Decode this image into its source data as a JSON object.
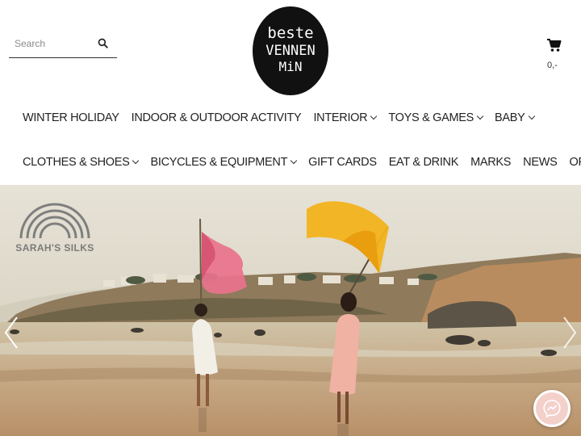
{
  "header": {
    "search": {
      "placeholder": "Search"
    },
    "logo": {
      "line1": "beste",
      "line2": "VENNEN",
      "line3": "MiN"
    },
    "cart": {
      "total": "0,-"
    }
  },
  "nav": {
    "row1": [
      {
        "label": "WINTER HOLIDAY",
        "has_dropdown": false
      },
      {
        "label": "INDOOR & OUTDOOR ACTIVITY",
        "has_dropdown": false
      },
      {
        "label": "INTERIOR",
        "has_dropdown": true
      },
      {
        "label": "TOYS & GAMES",
        "has_dropdown": true
      },
      {
        "label": "BABY",
        "has_dropdown": true
      }
    ],
    "row2": [
      {
        "label": "CLOTHES & SHOES",
        "has_dropdown": true
      },
      {
        "label": "BICYCLES & EQUIPMENT",
        "has_dropdown": true
      },
      {
        "label": "GIFT CARDS",
        "has_dropdown": false
      },
      {
        "label": "EAT & DRINK",
        "has_dropdown": false
      },
      {
        "label": "MARKS",
        "has_dropdown": false
      },
      {
        "label": "NEWS",
        "has_dropdown": false
      },
      {
        "label": "OFFER",
        "has_dropdown": false
      }
    ]
  },
  "hero": {
    "brand": "SARAH'S SILKS"
  },
  "colors": {
    "logo_bg": "#111111",
    "sky": "#d9d4c6",
    "sand": "#c7ab8a",
    "pink_silk": "#e9728c",
    "yellow_silk": "#f2b21c",
    "messenger_bg": "#f4d0cb"
  },
  "icons": {
    "search": "search-icon",
    "cart": "cart-icon",
    "prev": "chevron-left-icon",
    "next": "chevron-right-icon",
    "chat": "messenger-icon"
  }
}
